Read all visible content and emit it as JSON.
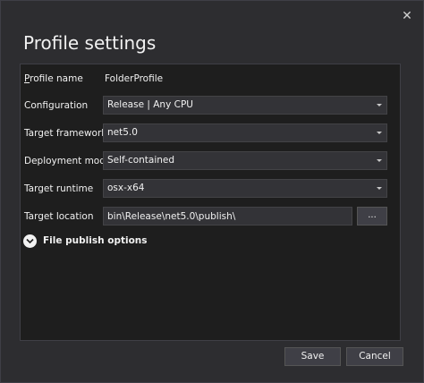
{
  "dialog": {
    "title": "Profile settings",
    "close_icon": "close-icon"
  },
  "form": {
    "profile_name": {
      "label_underlined": "P",
      "label_rest": "rofile name",
      "value": "FolderProfile"
    },
    "configuration": {
      "label": "Configuration",
      "value": "Release | Any CPU"
    },
    "target_framework": {
      "label": "Target framework",
      "value": "net5.0"
    },
    "deployment_mode": {
      "label": "Deployment mode",
      "value": "Self-contained"
    },
    "target_runtime": {
      "label": "Target runtime",
      "value": "osx-x64"
    },
    "target_location": {
      "label": "Target location",
      "value": "bin\\Release\\net5.0\\publish\\",
      "browse_label": "..."
    },
    "file_publish_options": {
      "label": "File publish options",
      "icon": "chevron-down-icon"
    }
  },
  "footer": {
    "save_label": "Save",
    "cancel_label": "Cancel"
  }
}
